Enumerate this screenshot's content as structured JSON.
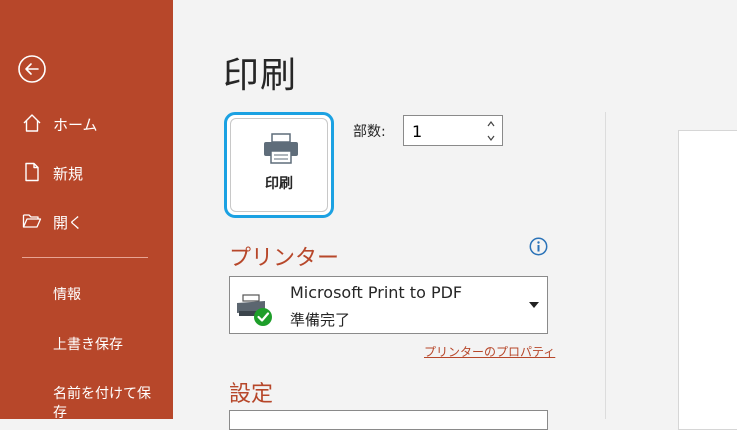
{
  "sidebar": {
    "items": [
      {
        "label": "ホーム",
        "icon": "home-icon"
      },
      {
        "label": "新規",
        "icon": "new-document-icon"
      },
      {
        "label": "開く",
        "icon": "open-folder-icon"
      }
    ],
    "text_items": [
      "情報",
      "上書き保存",
      "名前を付けて保",
      "存"
    ]
  },
  "main": {
    "title": "印刷",
    "print_button_label": "印刷",
    "copies_label": "部数:",
    "copies_value": "1",
    "printer_heading": "プリンター",
    "printer_name": "Microsoft Print to PDF",
    "printer_status": "準備完了",
    "printer_properties_link": "プリンターのプロパティ",
    "settings_heading": "設定"
  },
  "colors": {
    "accent": "#b7472a",
    "focus": "#1ba1e2",
    "ready_green": "#1e9e2a"
  }
}
